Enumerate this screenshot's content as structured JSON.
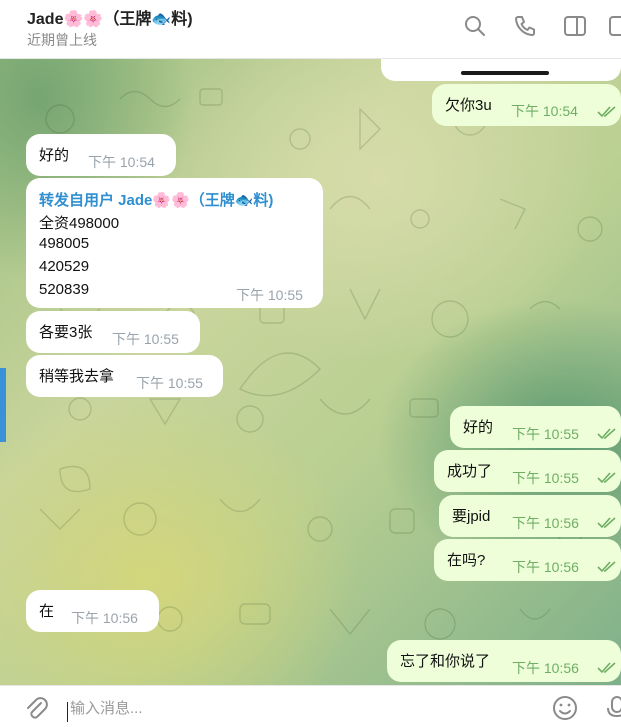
{
  "header": {
    "title": "Jade🌸🌸（王牌🐟料)",
    "status": "近期曾上线",
    "icons": [
      "search-icon",
      "phone-icon",
      "sidebar-toggle-icon",
      "more-icon"
    ]
  },
  "messages": [
    {
      "id": "m1",
      "dir": "out",
      "text": "欠你3u",
      "time": "下午 10:54",
      "read": true
    },
    {
      "id": "m2",
      "dir": "in",
      "text": "好的",
      "time": "下午 10:54"
    },
    {
      "id": "m3",
      "dir": "in",
      "forwarded_from": "转发自用户 Jade🌸🌸（王牌🐟料)",
      "lines": [
        "全资498000",
        "498005",
        "420529",
        "520839"
      ],
      "time": "下午 10:55"
    },
    {
      "id": "m4",
      "dir": "in",
      "text": "各要3张",
      "time": "下午 10:55"
    },
    {
      "id": "m5",
      "dir": "in",
      "text": "稍等我去拿",
      "time": "下午 10:55"
    },
    {
      "id": "m6",
      "dir": "out",
      "text": "好的",
      "time": "下午 10:55",
      "read": true
    },
    {
      "id": "m7",
      "dir": "out",
      "text": "成功了",
      "time": "下午 10:55",
      "read": true
    },
    {
      "id": "m8",
      "dir": "out",
      "text": "要jpid",
      "time": "下午 10:56",
      "read": true
    },
    {
      "id": "m9",
      "dir": "out",
      "text": "在吗?",
      "time": "下午 10:56",
      "read": true
    },
    {
      "id": "m10",
      "dir": "in",
      "text": "在",
      "time": "下午 10:56"
    },
    {
      "id": "m11",
      "dir": "out",
      "text": "忘了和你说了",
      "time": "下午 10:56",
      "read": true
    }
  ],
  "composer": {
    "placeholder": "输入消息...",
    "value": ""
  },
  "colors": {
    "outgoing_bubble": "#eefed9",
    "incoming_bubble": "#ffffff",
    "accent": "#3a90d9",
    "read_tick": "#6fae64",
    "forward_name": "#2f8fd0"
  }
}
